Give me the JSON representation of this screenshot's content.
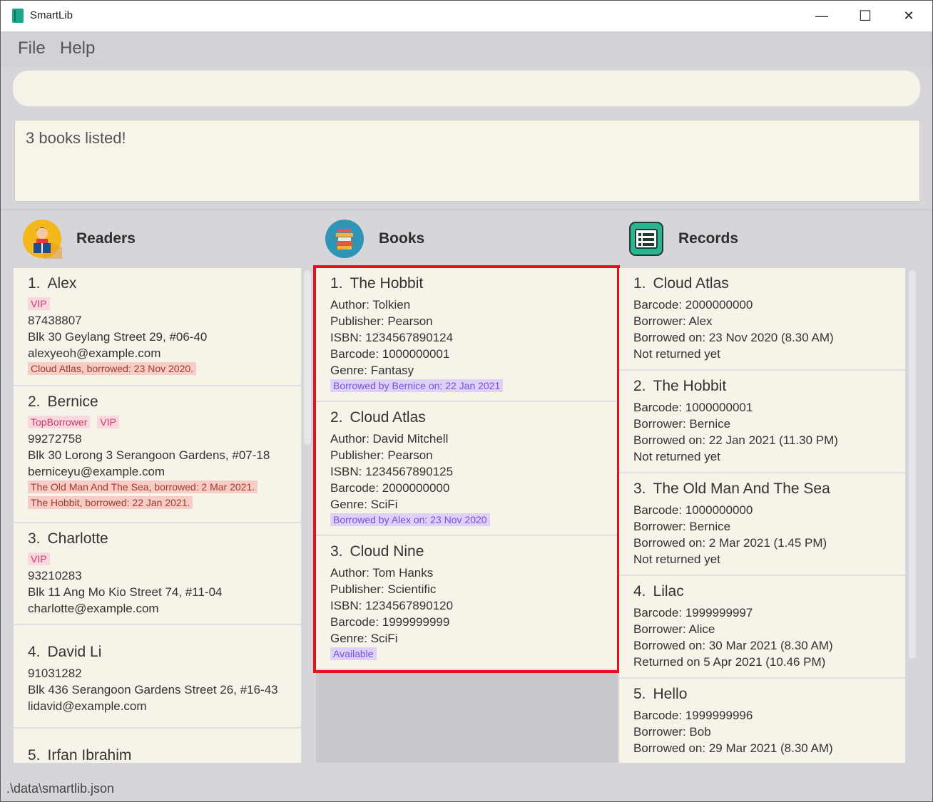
{
  "window": {
    "title": "SmartLib"
  },
  "titlebar_buttons": {
    "minimize": "—",
    "maximize": "☐",
    "close": "✕"
  },
  "menu": {
    "file": "File",
    "help": "Help"
  },
  "command": {
    "value": ""
  },
  "result": {
    "text": "3 books listed!"
  },
  "panels": {
    "readers": "Readers",
    "books": "Books",
    "records": "Records"
  },
  "readers": [
    {
      "index": "1.",
      "name": "Alex",
      "tags": [
        "VIP"
      ],
      "phone": "87438807",
      "address": "Blk 30 Geylang Street 29, #06-40",
      "email": "alexyeoh@example.com",
      "borrowed": [
        "Cloud Atlas, borrowed: 23 Nov 2020."
      ]
    },
    {
      "index": "2.",
      "name": "Bernice",
      "tags": [
        "TopBorrower",
        "VIP"
      ],
      "phone": "99272758",
      "address": "Blk 30 Lorong 3 Serangoon Gardens, #07-18",
      "email": "berniceyu@example.com",
      "borrowed": [
        "The Old Man And The Sea, borrowed: 2 Mar 2021.",
        "The Hobbit, borrowed: 22 Jan 2021."
      ]
    },
    {
      "index": "3.",
      "name": "Charlotte",
      "tags": [
        "VIP"
      ],
      "phone": "93210283",
      "address": "Blk 11 Ang Mo Kio Street 74, #11-04",
      "email": "charlotte@example.com",
      "borrowed": []
    },
    {
      "index": "4.",
      "name": "David Li",
      "tags": [],
      "phone": "91031282",
      "address": "Blk 436 Serangoon Gardens Street 26, #16-43",
      "email": "lidavid@example.com",
      "borrowed": []
    },
    {
      "index": "5.",
      "name": "Irfan Ibrahim",
      "tags": [],
      "phone": "",
      "address": "",
      "email": "",
      "borrowed": []
    }
  ],
  "books": [
    {
      "index": "1.",
      "title": "The Hobbit",
      "author": "Author: Tolkien",
      "publisher": "Publisher: Pearson",
      "isbn": "ISBN: 1234567890124",
      "barcode": "Barcode: 1000000001",
      "genre": "Genre: Fantasy",
      "status": "Borrowed by Bernice on: 22 Jan 2021"
    },
    {
      "index": "2.",
      "title": "Cloud Atlas",
      "author": "Author: David Mitchell",
      "publisher": "Publisher: Pearson",
      "isbn": "ISBN: 1234567890125",
      "barcode": "Barcode: 2000000000",
      "genre": "Genre: SciFi",
      "status": "Borrowed by Alex on: 23 Nov 2020"
    },
    {
      "index": "3.",
      "title": "Cloud Nine",
      "author": "Author: Tom Hanks",
      "publisher": "Publisher: Scientific",
      "isbn": "ISBN: 1234567890120",
      "barcode": "Barcode: 1999999999",
      "genre": "Genre: SciFi",
      "status": "Available"
    }
  ],
  "records": [
    {
      "index": "1.",
      "title": "Cloud Atlas",
      "barcode": "Barcode: 2000000000",
      "borrower": "Borrower: Alex",
      "borrowed": "Borrowed on: 23 Nov 2020 (8.30 AM)",
      "returned": "Not returned yet"
    },
    {
      "index": "2.",
      "title": "The Hobbit",
      "barcode": "Barcode: 1000000001",
      "borrower": "Borrower: Bernice",
      "borrowed": "Borrowed on: 22 Jan 2021 (11.30 PM)",
      "returned": "Not returned yet"
    },
    {
      "index": "3.",
      "title": "The Old Man And The Sea",
      "barcode": "Barcode: 1000000000",
      "borrower": "Borrower: Bernice",
      "borrowed": "Borrowed on: 2 Mar 2021 (1.45 PM)",
      "returned": "Not returned yet"
    },
    {
      "index": "4.",
      "title": "Lilac",
      "barcode": "Barcode: 1999999997",
      "borrower": "Borrower: Alice",
      "borrowed": "Borrowed on: 30 Mar 2021 (8.30 AM)",
      "returned": "Returned on 5 Apr 2021 (10.46 PM)"
    },
    {
      "index": "5.",
      "title": "Hello",
      "barcode": "Barcode: 1999999996",
      "borrower": "Borrower: Bob",
      "borrowed": "Borrowed on: 29 Mar 2021 (8.30 AM)",
      "returned": ""
    }
  ],
  "status": {
    "path": ".\\data\\smartlib.json"
  }
}
